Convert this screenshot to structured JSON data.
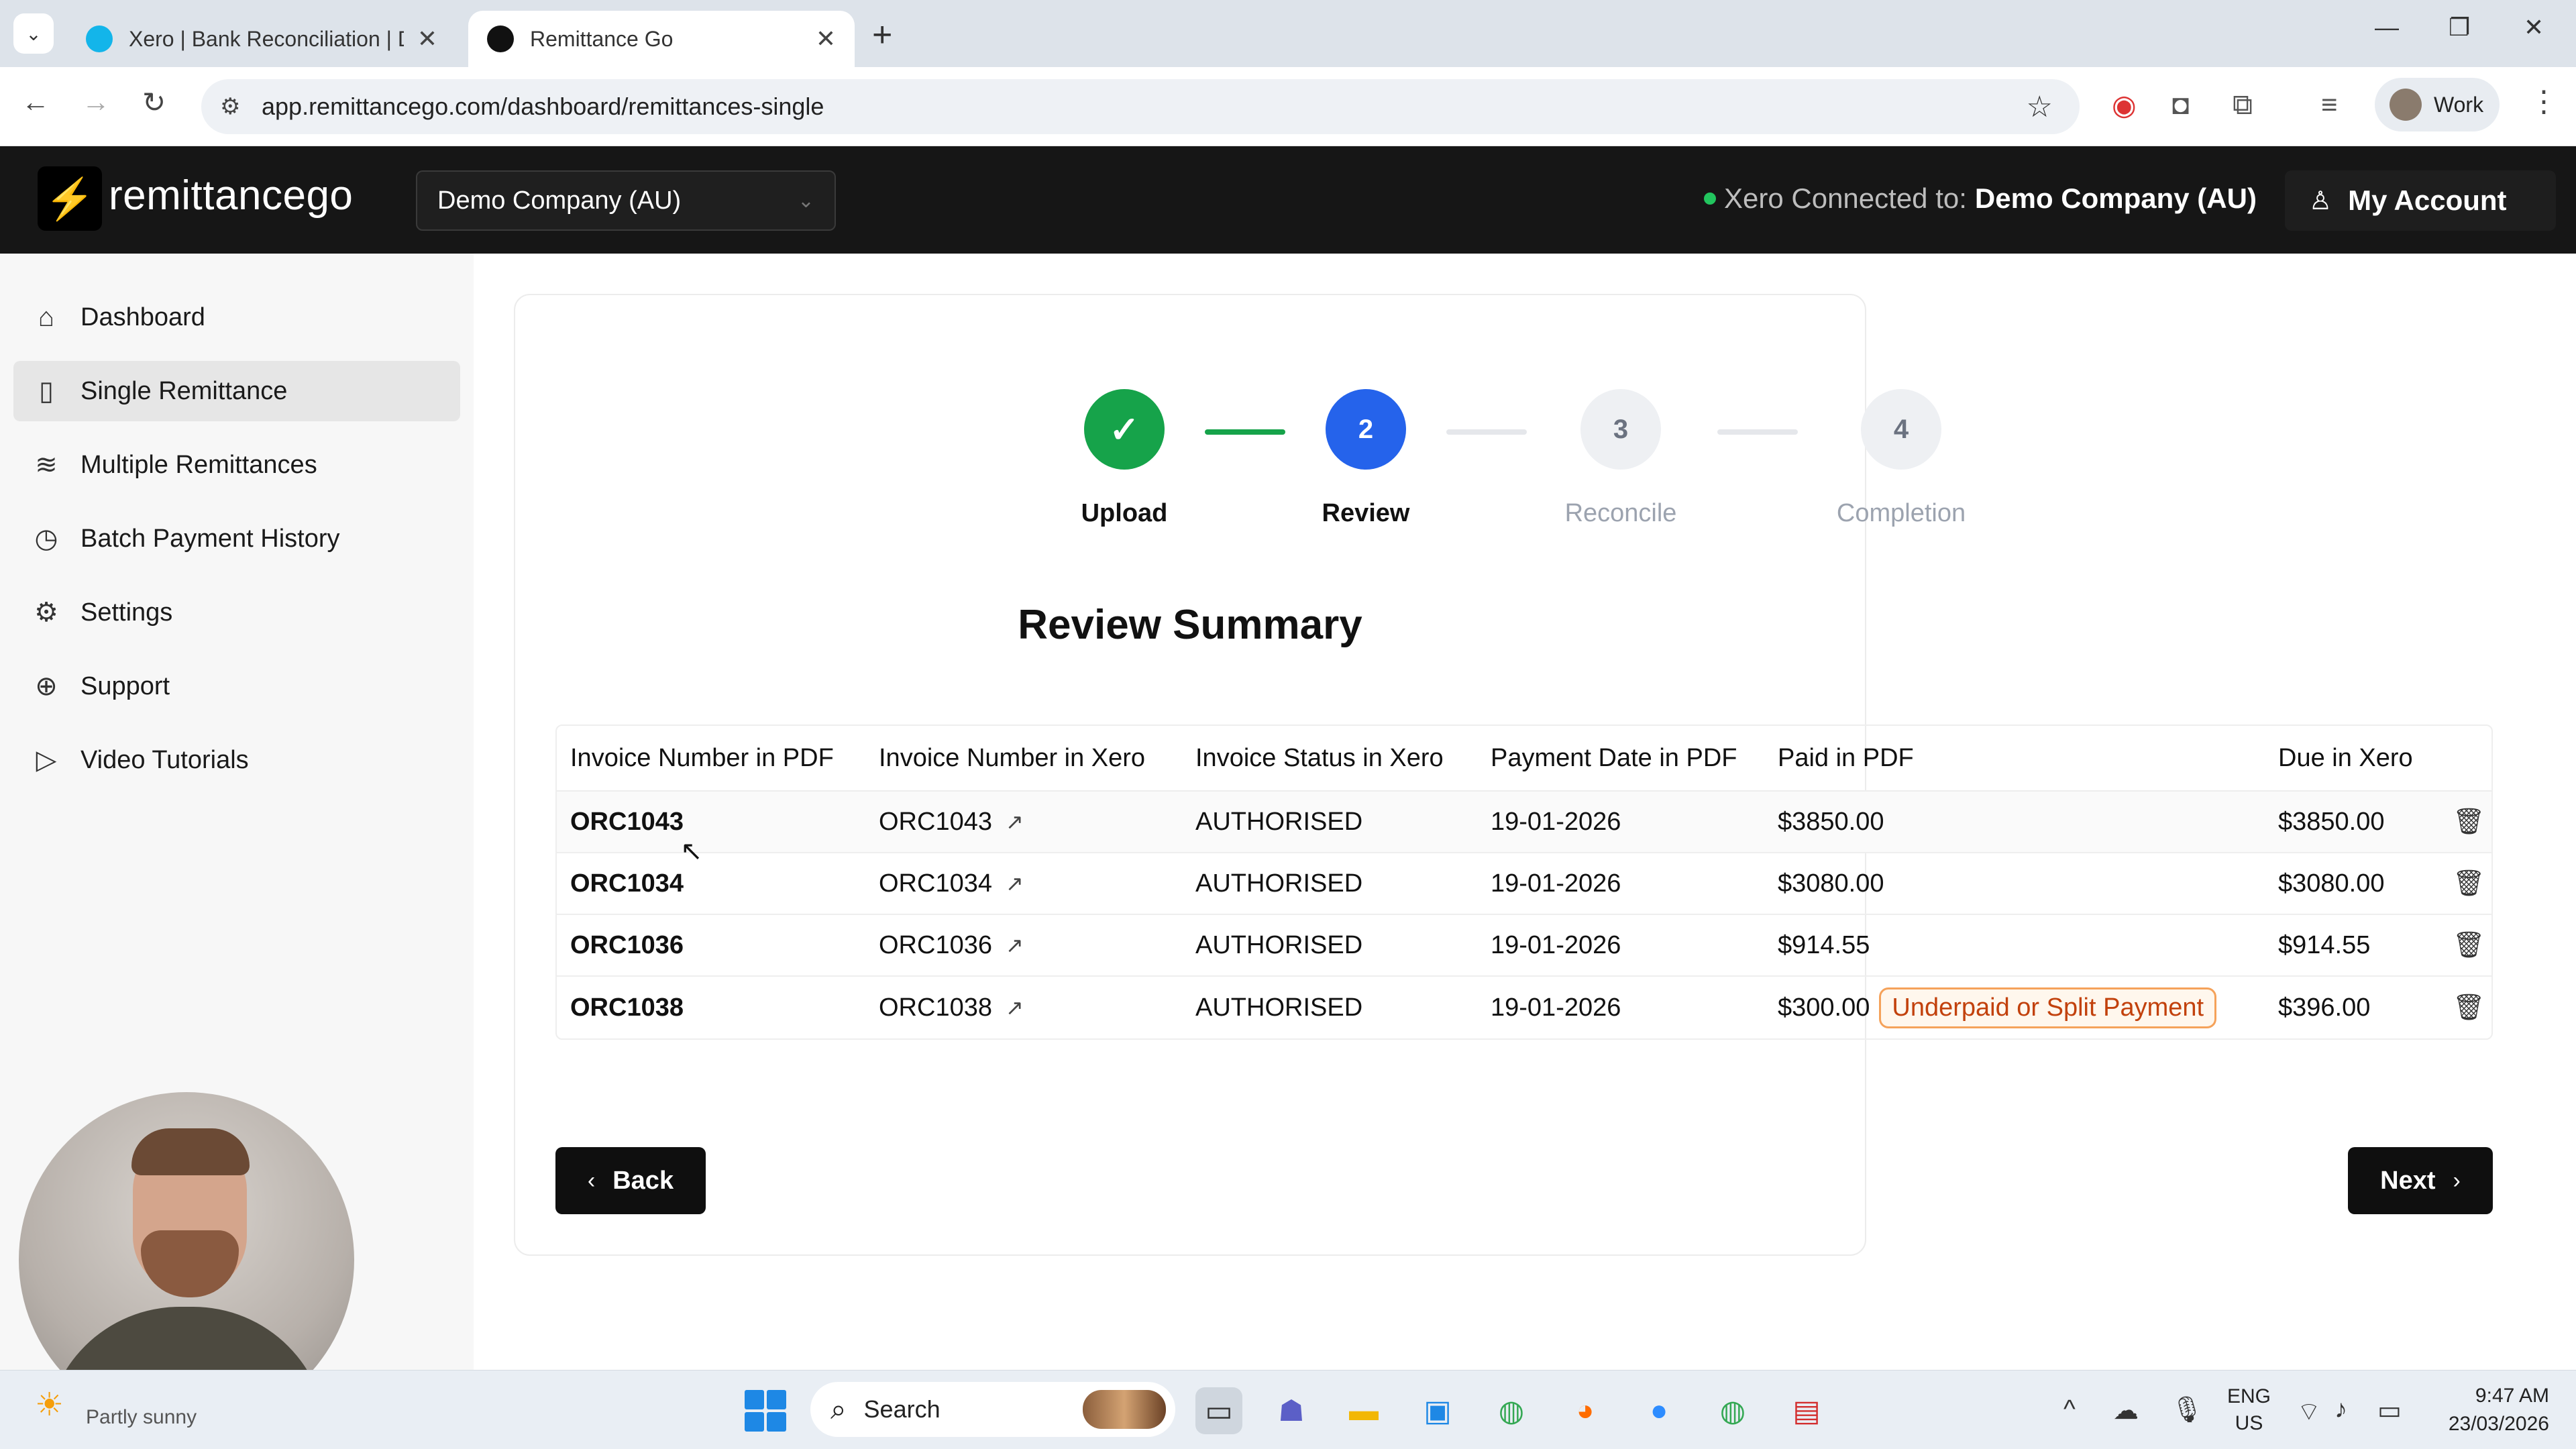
{
  "browser": {
    "tabs": [
      {
        "title": "Xero | Bank Reconciliation | Dem",
        "favicon_color": "#13b5ea"
      },
      {
        "title": "Remittance Go",
        "favicon_color": "#111111"
      }
    ],
    "url": "app.remittancego.com/dashboard/remittances-single",
    "profile_label": "Work",
    "icons": {
      "back": "back-arrow-icon",
      "forward": "forward-arrow-icon",
      "reload": "reload-icon",
      "site_info": "site-info-icon",
      "bookmark": "star-icon"
    }
  },
  "header": {
    "logo_text": "remittancego",
    "company_selector": "Demo Company (AU)",
    "xero_status_label": "Xero Connected to:",
    "xero_company": "Demo Company (AU)",
    "account_label": "My Account"
  },
  "sidebar": {
    "items": [
      {
        "label": "Dashboard",
        "icon": "home-icon",
        "glyph": "⌂"
      },
      {
        "label": "Single Remittance",
        "icon": "document-icon",
        "glyph": "🗋"
      },
      {
        "label": "Multiple Remittances",
        "icon": "layers-icon",
        "glyph": "≋"
      },
      {
        "label": "Batch Payment History",
        "icon": "clock-icon",
        "glyph": "◷"
      },
      {
        "label": "Settings",
        "icon": "gear-icon",
        "glyph": "⚙"
      },
      {
        "label": "Support",
        "icon": "lifebuoy-icon",
        "glyph": "⊕"
      },
      {
        "label": "Video Tutorials",
        "icon": "play-circle-icon",
        "glyph": "▷"
      }
    ],
    "active_index": 1
  },
  "stepper": {
    "steps": [
      {
        "number": "1",
        "label": "Upload",
        "state": "done"
      },
      {
        "number": "2",
        "label": "Review",
        "state": "current"
      },
      {
        "number": "3",
        "label": "Reconcile",
        "state": "pending"
      },
      {
        "number": "4",
        "label": "Completion",
        "state": "pending"
      }
    ]
  },
  "summary": {
    "title": "Review Summary",
    "columns": [
      "Invoice Number in PDF",
      "Invoice Number in Xero",
      "Invoice Status in Xero",
      "Payment Date in PDF",
      "Paid in PDF",
      "Due in Xero"
    ],
    "rows": [
      {
        "pdf_invoice": "ORC1043",
        "xero_invoice": "ORC1043",
        "status": "AUTHORISED",
        "payment_date": "19-01-2026",
        "paid": "$3850.00",
        "badge": "",
        "due": "$3850.00"
      },
      {
        "pdf_invoice": "ORC1034",
        "xero_invoice": "ORC1034",
        "status": "AUTHORISED",
        "payment_date": "19-01-2026",
        "paid": "$3080.00",
        "badge": "",
        "due": "$3080.00"
      },
      {
        "pdf_invoice": "ORC1036",
        "xero_invoice": "ORC1036",
        "status": "AUTHORISED",
        "payment_date": "19-01-2026",
        "paid": "$914.55",
        "badge": "",
        "due": "$914.55"
      },
      {
        "pdf_invoice": "ORC1038",
        "xero_invoice": "ORC1038",
        "status": "AUTHORISED",
        "payment_date": "19-01-2026",
        "paid": "$300.00",
        "badge": "Underpaid or Split Payment",
        "due": "$396.00"
      }
    ]
  },
  "actions": {
    "back_label": "Back",
    "next_label": "Next"
  },
  "taskbar": {
    "weather_text": "Partly sunny",
    "search_placeholder": "Search",
    "lang_line1": "ENG",
    "lang_line2": "US",
    "time": "9:47 AM",
    "date": "23/03/2026"
  },
  "colors": {
    "accent_blue": "#2563eb",
    "success_green": "#16a34a",
    "warning_orange": "#f5a25a",
    "header_bg": "#161616"
  }
}
